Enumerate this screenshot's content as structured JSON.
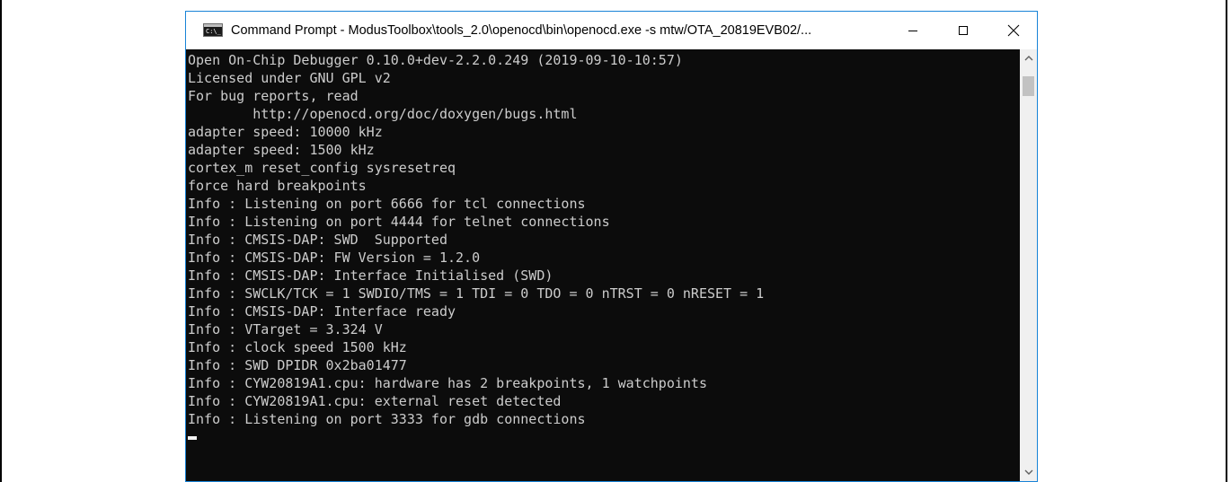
{
  "window": {
    "title": "Command Prompt - ModusToolbox\\tools_2.0\\openocd\\bin\\openocd.exe  -s mtw/OTA_20819EVB02/...",
    "icon_label": "C:\\_",
    "controls": {
      "minimize_icon": "minimize-icon",
      "maximize_icon": "maximize-icon",
      "close_icon": "close-icon"
    }
  },
  "console": {
    "lines": [
      "Open On-Chip Debugger 0.10.0+dev-2.2.0.249 (2019-09-10-10:57)",
      "Licensed under GNU GPL v2",
      "For bug reports, read",
      "        http://openocd.org/doc/doxygen/bugs.html",
      "adapter speed: 10000 kHz",
      "adapter speed: 1500 kHz",
      "cortex_m reset_config sysresetreq",
      "force hard breakpoints",
      "Info : Listening on port 6666 for tcl connections",
      "Info : Listening on port 4444 for telnet connections",
      "Info : CMSIS-DAP: SWD  Supported",
      "Info : CMSIS-DAP: FW Version = 1.2.0",
      "Info : CMSIS-DAP: Interface Initialised (SWD)",
      "Info : SWCLK/TCK = 1 SWDIO/TMS = 1 TDI = 0 TDO = 0 nTRST = 0 nRESET = 1",
      "Info : CMSIS-DAP: Interface ready",
      "Info : VTarget = 3.324 V",
      "Info : clock speed 1500 kHz",
      "Info : SWD DPIDR 0x2ba01477",
      "Info : CYW20819A1.cpu: hardware has 2 breakpoints, 1 watchpoints",
      "Info : CYW20819A1.cpu: external reset detected",
      "Info : Listening on port 3333 for gdb connections",
      ""
    ]
  },
  "colors": {
    "console_bg": "#0c0c0c",
    "console_text": "#cccccc",
    "window_border": "#1883d7",
    "titlebar_bg": "#ffffff"
  }
}
